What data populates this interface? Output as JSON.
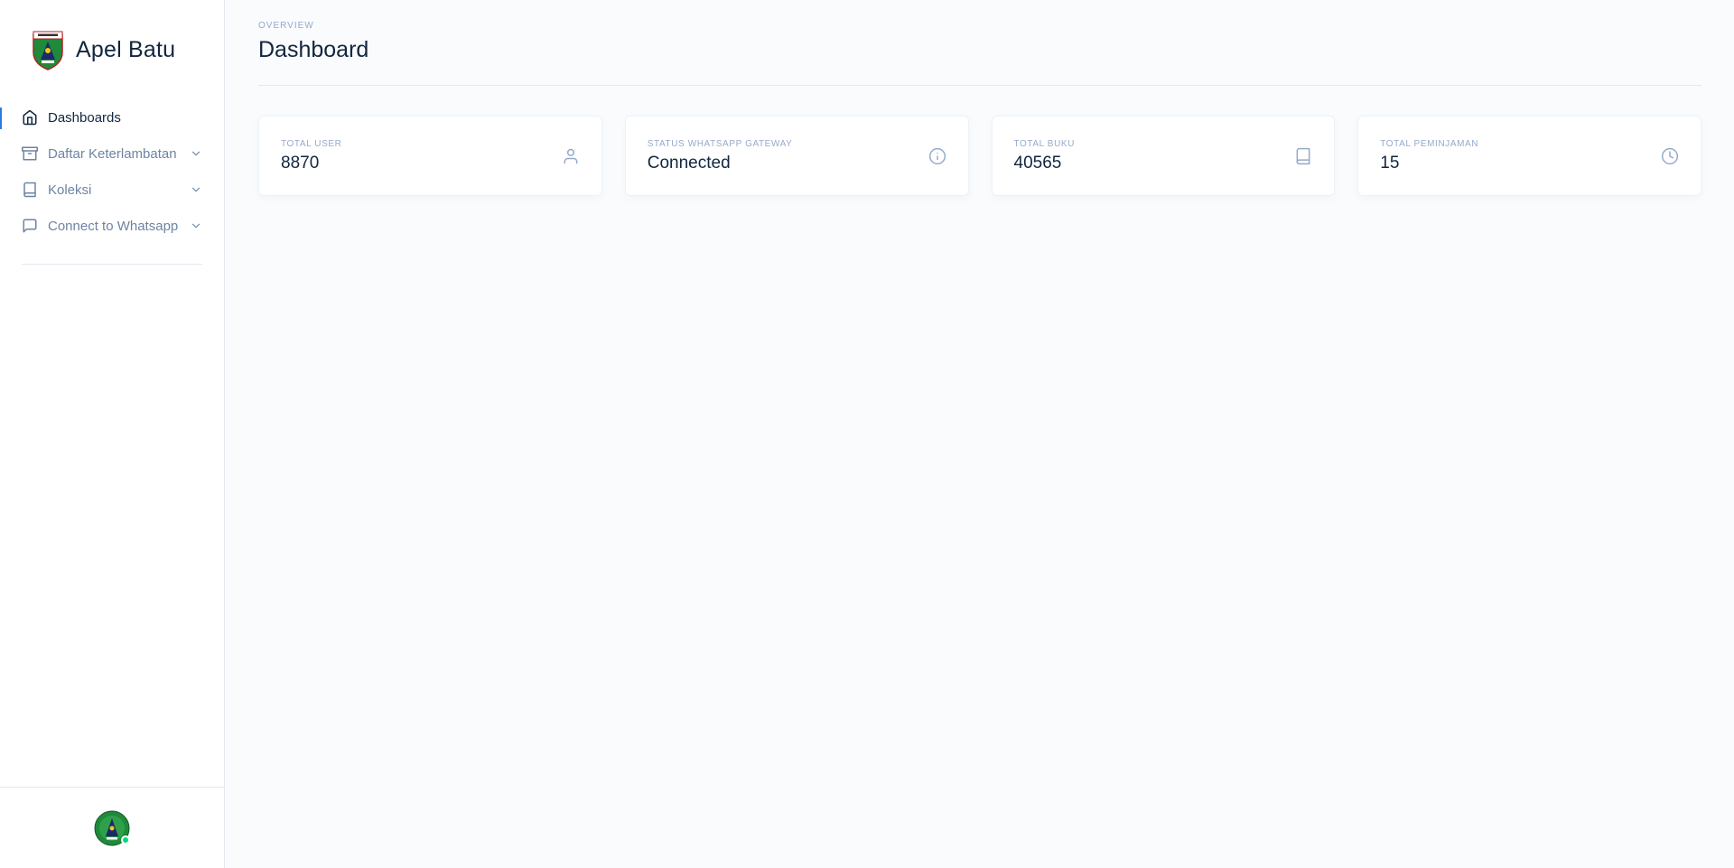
{
  "app": {
    "name": "Apel Batu"
  },
  "colors": {
    "accent": "#2c7be5",
    "text_dark": "#12263f",
    "text_muted": "#6e84a3",
    "status_online": "#00d97e",
    "background": "#f9fbfd"
  },
  "sidebar": {
    "items": [
      {
        "label": "Dashboards",
        "icon": "home-icon",
        "active": true,
        "has_submenu": false
      },
      {
        "label": "Daftar Keterlambatan",
        "icon": "archive-icon",
        "active": false,
        "has_submenu": true
      },
      {
        "label": "Koleksi",
        "icon": "book-icon",
        "active": false,
        "has_submenu": true
      },
      {
        "label": "Connect to Whatsapp",
        "icon": "message-square-icon",
        "active": false,
        "has_submenu": true
      }
    ],
    "footer": {
      "avatar_icon": "user-avatar-icon",
      "status": "online"
    }
  },
  "header": {
    "pretitle": "OVERVIEW",
    "title": "Dashboard"
  },
  "cards": [
    {
      "label": "TOTAL USER",
      "value": "8870",
      "icon": "user-icon"
    },
    {
      "label": "STATUS WHATSAPP GATEWAY",
      "value": "Connected",
      "icon": "info-icon"
    },
    {
      "label": "TOTAL BUKU",
      "value": "40565",
      "icon": "book-icon"
    },
    {
      "label": "TOTAL PEMINJAMAN",
      "value": "15",
      "icon": "clock-icon"
    }
  ]
}
